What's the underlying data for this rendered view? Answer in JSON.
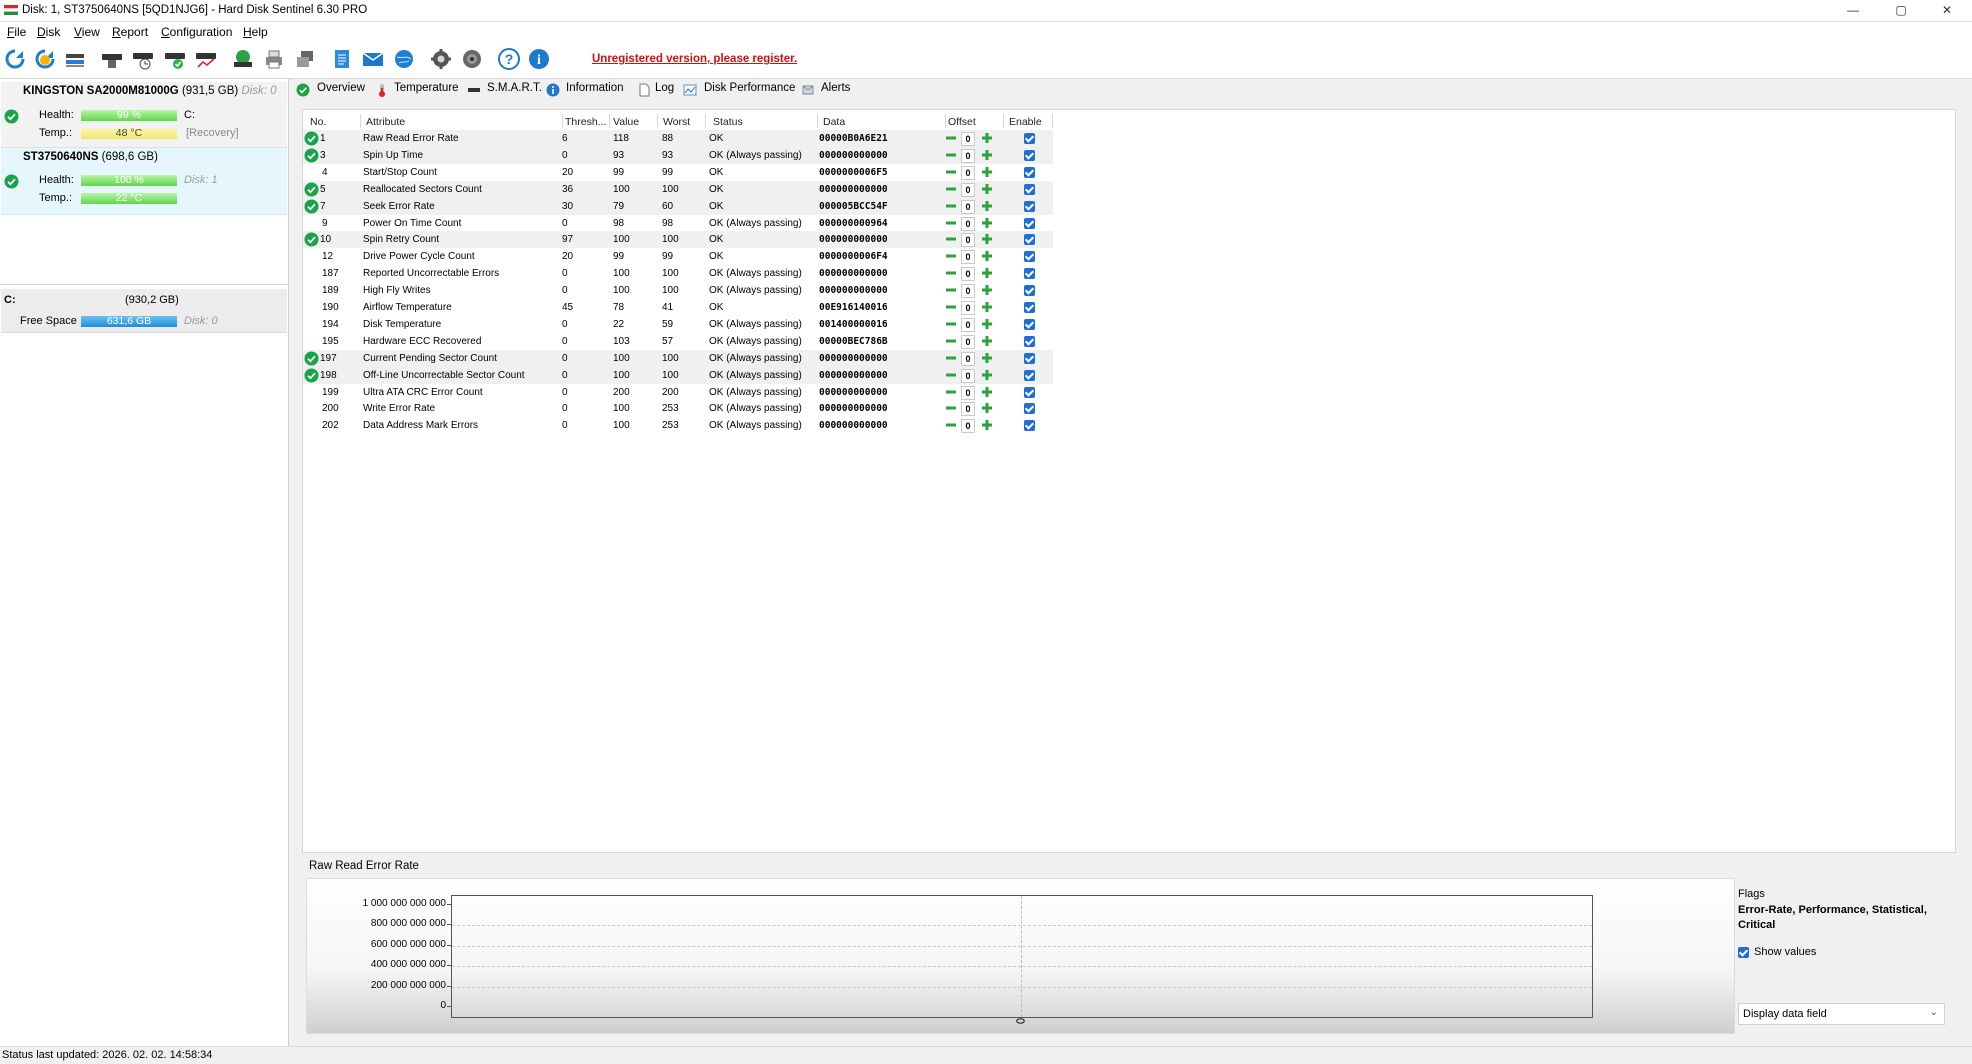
{
  "window": {
    "title": "Disk: 1, ST3750640NS [5QD1NJG6]  -  Hard Disk Sentinel 6.30 PRO",
    "minimize": "—",
    "maximize": "▢",
    "close": "✕"
  },
  "menu": [
    "File",
    "Disk",
    "View",
    "Report",
    "Configuration",
    "Help"
  ],
  "toolbar": {
    "icons": [
      "refresh-icon",
      "refresh-warning-icon",
      "disk-list-icon",
      "disk-icon",
      "disk-clock-icon",
      "disk-ok-icon",
      "disk-graph-icon",
      "globe-disk-icon",
      "printer-icon",
      "disk-copy-icon",
      "notes-icon",
      "email-icon",
      "globe-network-icon",
      "gear-icon",
      "speaker-icon",
      "help-icon",
      "info-icon"
    ],
    "register_text": "Unregistered version, please register."
  },
  "left": {
    "disks": [
      {
        "name": "KINGSTON SA2000M81000G",
        "size": "(931,5 GB)",
        "disk_no": "Disk: 0",
        "health_label": "Health:",
        "health": "99 %",
        "health_pct": 99,
        "temp_label": "Temp.:",
        "temp": "48 °C",
        "drive": "C:",
        "extra": "[Recovery]"
      },
      {
        "name": "ST3750640NS",
        "size": "(698,6 GB)",
        "disk_no": "Disk: 1",
        "health_label": "Health:",
        "health": "100 %",
        "health_pct": 100,
        "temp_label": "Temp.:",
        "temp": "22 °C"
      }
    ],
    "volume": {
      "drive": "C:",
      "size": "(930,2 GB)",
      "free_label": "Free Space",
      "free": "631,6 GB",
      "free_pct": 68,
      "disk_no": "Disk: 0"
    }
  },
  "tabs": [
    {
      "label": "Overview",
      "icon": "check-circle-icon"
    },
    {
      "label": "Temperature",
      "icon": "thermometer-icon"
    },
    {
      "label": "S.M.A.R.T.",
      "icon": "smart-drive-icon"
    },
    {
      "label": "Information",
      "icon": "info-circle-icon"
    },
    {
      "label": "Log",
      "icon": "document-icon"
    },
    {
      "label": "Disk Performance",
      "icon": "chart-icon"
    },
    {
      "label": "Alerts",
      "icon": "alerts-icon"
    }
  ],
  "smart": {
    "headers": {
      "no": "No.",
      "attribute": "Attribute",
      "threshold": "Thresh...",
      "value": "Value",
      "worst": "Worst",
      "status": "Status",
      "data": "Data",
      "offset": "Offset",
      "enable": "Enable"
    },
    "rows": [
      {
        "no": "1",
        "attribute": "Raw Read Error Rate",
        "threshold": "6",
        "value": "118",
        "worst": "88",
        "status": "OK",
        "data": "00000B0A6E21",
        "offset": "0",
        "ok": true,
        "hl": true
      },
      {
        "no": "3",
        "attribute": "Spin Up Time",
        "threshold": "0",
        "value": "93",
        "worst": "93",
        "status": "OK (Always passing)",
        "data": "000000000000",
        "offset": "0",
        "ok": true,
        "hl": true
      },
      {
        "no": "4",
        "attribute": "Start/Stop Count",
        "threshold": "20",
        "value": "99",
        "worst": "99",
        "status": "OK",
        "data": "0000000006F5",
        "offset": "0",
        "ok": false,
        "hl": false
      },
      {
        "no": "5",
        "attribute": "Reallocated Sectors Count",
        "threshold": "36",
        "value": "100",
        "worst": "100",
        "status": "OK",
        "data": "000000000000",
        "offset": "0",
        "ok": true,
        "hl": true
      },
      {
        "no": "7",
        "attribute": "Seek Error Rate",
        "threshold": "30",
        "value": "79",
        "worst": "60",
        "status": "OK",
        "data": "000005BCC54F",
        "offset": "0",
        "ok": true,
        "hl": true
      },
      {
        "no": "9",
        "attribute": "Power On Time Count",
        "threshold": "0",
        "value": "98",
        "worst": "98",
        "status": "OK (Always passing)",
        "data": "000000000964",
        "offset": "0",
        "ok": false,
        "hl": false
      },
      {
        "no": "10",
        "attribute": "Spin Retry Count",
        "threshold": "97",
        "value": "100",
        "worst": "100",
        "status": "OK",
        "data": "000000000000",
        "offset": "0",
        "ok": true,
        "hl": true
      },
      {
        "no": "12",
        "attribute": "Drive Power Cycle Count",
        "threshold": "20",
        "value": "99",
        "worst": "99",
        "status": "OK",
        "data": "0000000006F4",
        "offset": "0",
        "ok": false,
        "hl": false
      },
      {
        "no": "187",
        "attribute": "Reported Uncorrectable Errors",
        "threshold": "0",
        "value": "100",
        "worst": "100",
        "status": "OK (Always passing)",
        "data": "000000000000",
        "offset": "0",
        "ok": false,
        "hl": false
      },
      {
        "no": "189",
        "attribute": "High Fly Writes",
        "threshold": "0",
        "value": "100",
        "worst": "100",
        "status": "OK (Always passing)",
        "data": "000000000000",
        "offset": "0",
        "ok": false,
        "hl": false
      },
      {
        "no": "190",
        "attribute": "Airflow Temperature",
        "threshold": "45",
        "value": "78",
        "worst": "41",
        "status": "OK",
        "data": "00E916140016",
        "offset": "0",
        "ok": false,
        "hl": false
      },
      {
        "no": "194",
        "attribute": "Disk Temperature",
        "threshold": "0",
        "value": "22",
        "worst": "59",
        "status": "OK (Always passing)",
        "data": "001400000016",
        "offset": "0",
        "ok": false,
        "hl": false
      },
      {
        "no": "195",
        "attribute": "Hardware ECC Recovered",
        "threshold": "0",
        "value": "103",
        "worst": "57",
        "status": "OK (Always passing)",
        "data": "00000BEC786B",
        "offset": "0",
        "ok": false,
        "hl": false
      },
      {
        "no": "197",
        "attribute": "Current Pending Sector Count",
        "threshold": "0",
        "value": "100",
        "worst": "100",
        "status": "OK (Always passing)",
        "data": "000000000000",
        "offset": "0",
        "ok": true,
        "hl": true
      },
      {
        "no": "198",
        "attribute": "Off-Line Uncorrectable Sector Count",
        "threshold": "0",
        "value": "100",
        "worst": "100",
        "status": "OK (Always passing)",
        "data": "000000000000",
        "offset": "0",
        "ok": true,
        "hl": true
      },
      {
        "no": "199",
        "attribute": "Ultra ATA CRC Error Count",
        "threshold": "0",
        "value": "200",
        "worst": "200",
        "status": "OK (Always passing)",
        "data": "000000000000",
        "offset": "0",
        "ok": false,
        "hl": false
      },
      {
        "no": "200",
        "attribute": "Write Error Rate",
        "threshold": "0",
        "value": "100",
        "worst": "253",
        "status": "OK (Always passing)",
        "data": "000000000000",
        "offset": "0",
        "ok": false,
        "hl": false
      },
      {
        "no": "202",
        "attribute": "Data Address Mark Errors",
        "threshold": "0",
        "value": "100",
        "worst": "253",
        "status": "OK (Always passing)",
        "data": "000000000000",
        "offset": "0",
        "ok": false,
        "hl": false
      }
    ]
  },
  "detail": {
    "title": "Raw Read Error Rate",
    "yticks": [
      "1 000 000 000 000",
      "800 000 000 000",
      "600 000 000 000",
      "400 000 000 000",
      "200 000 000 000",
      "0"
    ],
    "flags_label": "Flags",
    "flags_value": "Error-Rate, Performance, Statistical, Critical",
    "show_values": "Show values",
    "select_value": "Display data field"
  },
  "chart_data": {
    "type": "line",
    "title": "Raw Read Error Rate",
    "ylim": [
      0,
      1000000000000
    ],
    "series": [],
    "grid": true
  },
  "status": {
    "text": "Status last updated: 2026. 02. 02. 14:58:34"
  }
}
